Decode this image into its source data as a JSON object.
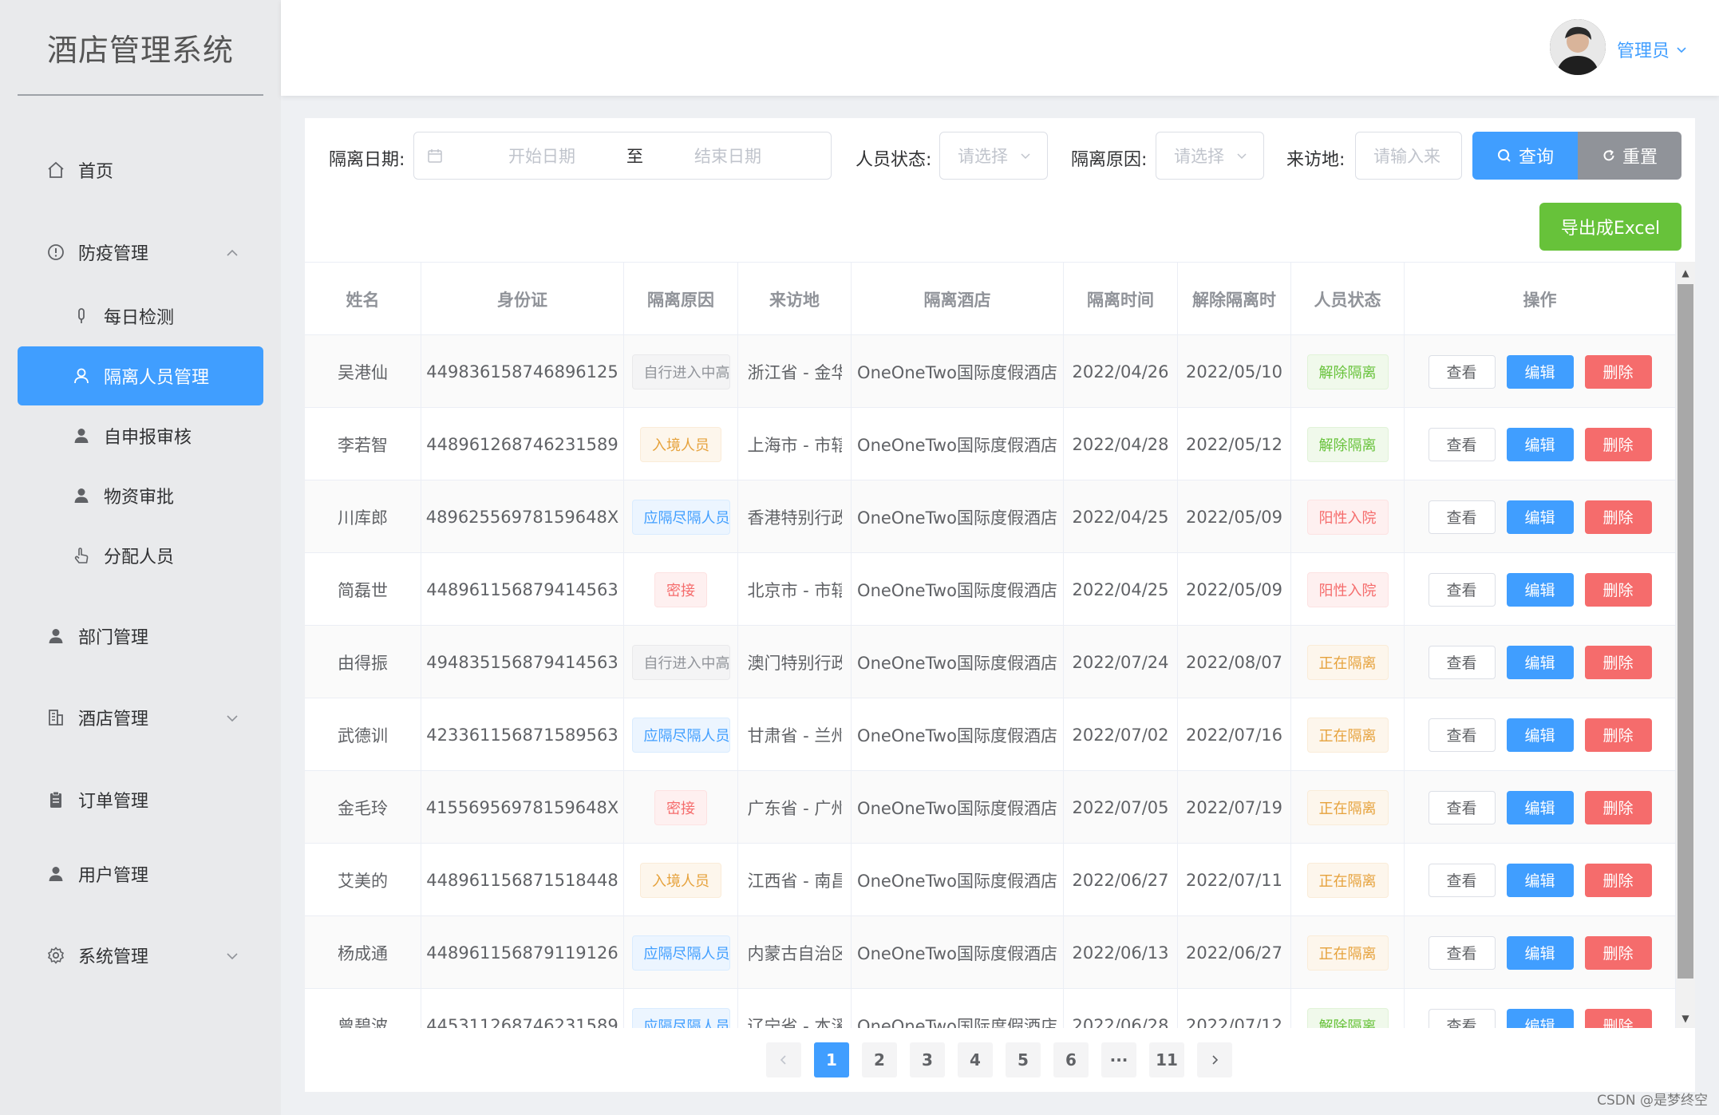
{
  "app": {
    "title": "酒店管理系统"
  },
  "sidebar": {
    "items": [
      {
        "label": "首页",
        "icon": "home-icon"
      },
      {
        "label": "防疫管理",
        "icon": "info-circle-icon",
        "expanded": true
      },
      {
        "label": "每日检测",
        "icon": "thermometer-icon",
        "sub": true
      },
      {
        "label": "隔离人员管理",
        "icon": "user-icon",
        "sub": true,
        "active": true
      },
      {
        "label": "自申报审核",
        "icon": "person-icon",
        "sub": true
      },
      {
        "label": "物资审批",
        "icon": "person-icon",
        "sub": true
      },
      {
        "label": "分配人员",
        "icon": "hand-pointer-icon",
        "sub": true
      },
      {
        "label": "部门管理",
        "icon": "person-icon"
      },
      {
        "label": "酒店管理",
        "icon": "building-icon",
        "expandable": true
      },
      {
        "label": "订单管理",
        "icon": "clipboard-icon"
      },
      {
        "label": "用户管理",
        "icon": "user-filled-icon"
      },
      {
        "label": "系统管理",
        "icon": "gear-icon",
        "expandable": true
      }
    ]
  },
  "header": {
    "user_name": "管理员"
  },
  "filters": {
    "date_label": "隔离日期:",
    "start_placeholder": "开始日期",
    "range_separator": "至",
    "end_placeholder": "结束日期",
    "status_label": "人员状态:",
    "status_placeholder": "请选择",
    "reason_label": "隔离原因:",
    "reason_placeholder": "请选择",
    "origin_label": "来访地:",
    "origin_placeholder": "请输入来",
    "search_button": "查询",
    "reset_button": "重置",
    "export_button": "导出成Excel"
  },
  "table": {
    "columns": [
      "姓名",
      "身份证",
      "隔离原因",
      "来访地",
      "隔离酒店",
      "隔离时间",
      "解除隔离时",
      "人员状态",
      "操作"
    ],
    "actions": {
      "view": "查看",
      "edit": "编辑",
      "delete": "删除"
    },
    "rows": [
      {
        "name": "吴港仙",
        "id": "449836158746896125",
        "reason": "自行进入中高风险地区",
        "reason_tag": "gray",
        "origin": "浙江省 - 金华",
        "hotel": "OneOneTwo国际度假酒店",
        "start": "2022/04/26",
        "end": "2022/05/10",
        "status": "解除隔离",
        "status_tag": "green"
      },
      {
        "name": "李若智",
        "id": "448961268746231589",
        "reason": "入境人员",
        "reason_tag": "orange",
        "origin": "上海市 - 市辖",
        "hotel": "OneOneTwo国际度假酒店",
        "start": "2022/04/28",
        "end": "2022/05/12",
        "status": "解除隔离",
        "status_tag": "green"
      },
      {
        "name": "川库郎",
        "id": "48962556978159648X",
        "reason": "应隔尽隔人员",
        "reason_tag": "blue",
        "origin": "香港特别行政区",
        "hotel": "OneOneTwo国际度假酒店",
        "start": "2022/04/25",
        "end": "2022/05/09",
        "status": "阳性入院",
        "status_tag": "red"
      },
      {
        "name": "简磊世",
        "id": "448961156879414563",
        "reason": "密接",
        "reason_tag": "red",
        "origin": "北京市 - 市辖",
        "hotel": "OneOneTwo国际度假酒店",
        "start": "2022/04/25",
        "end": "2022/05/09",
        "status": "阳性入院",
        "status_tag": "red"
      },
      {
        "name": "由得振",
        "id": "494835156879414563",
        "reason": "自行进入中高风险地区",
        "reason_tag": "gray",
        "origin": "澳门特别行政区",
        "hotel": "OneOneTwo国际度假酒店",
        "start": "2022/07/24",
        "end": "2022/08/07",
        "status": "正在隔离",
        "status_tag": "orange"
      },
      {
        "name": "武德训",
        "id": "423361156871589563",
        "reason": "应隔尽隔人员",
        "reason_tag": "blue",
        "origin": "甘肃省 - 兰州",
        "hotel": "OneOneTwo国际度假酒店",
        "start": "2022/07/02",
        "end": "2022/07/16",
        "status": "正在隔离",
        "status_tag": "orange"
      },
      {
        "name": "金毛玲",
        "id": "41556956978159648X",
        "reason": "密接",
        "reason_tag": "red",
        "origin": "广东省 - 广州",
        "hotel": "OneOneTwo国际度假酒店",
        "start": "2022/07/05",
        "end": "2022/07/19",
        "status": "正在隔离",
        "status_tag": "orange"
      },
      {
        "name": "艾美的",
        "id": "448961156871518448",
        "reason": "入境人员",
        "reason_tag": "orange",
        "origin": "江西省 - 南昌",
        "hotel": "OneOneTwo国际度假酒店",
        "start": "2022/06/27",
        "end": "2022/07/11",
        "status": "正在隔离",
        "status_tag": "orange"
      },
      {
        "name": "杨成通",
        "id": "448961156879119126",
        "reason": "应隔尽隔人员",
        "reason_tag": "blue",
        "origin": "内蒙古自治区",
        "hotel": "OneOneTwo国际度假酒店",
        "start": "2022/06/13",
        "end": "2022/06/27",
        "status": "正在隔离",
        "status_tag": "orange"
      },
      {
        "name": "曾碧波",
        "id": "445311268746231589",
        "reason": "应隔尽隔人员",
        "reason_tag": "blue",
        "origin": "辽宁省 - 本溪",
        "hotel": "OneOneTwo国际度假酒店",
        "start": "2022/06/28",
        "end": "2022/07/12",
        "status": "解除隔离",
        "status_tag": "green"
      }
    ]
  },
  "pagination": {
    "pages": [
      "1",
      "2",
      "3",
      "4",
      "5",
      "6",
      "···",
      "11"
    ],
    "current": "1"
  },
  "watermark": "CSDN @是梦终空",
  "colors": {
    "primary": "#409eff",
    "success": "#67c23a",
    "danger": "#f56c6c",
    "warning": "#e6a23c",
    "info": "#909399"
  }
}
